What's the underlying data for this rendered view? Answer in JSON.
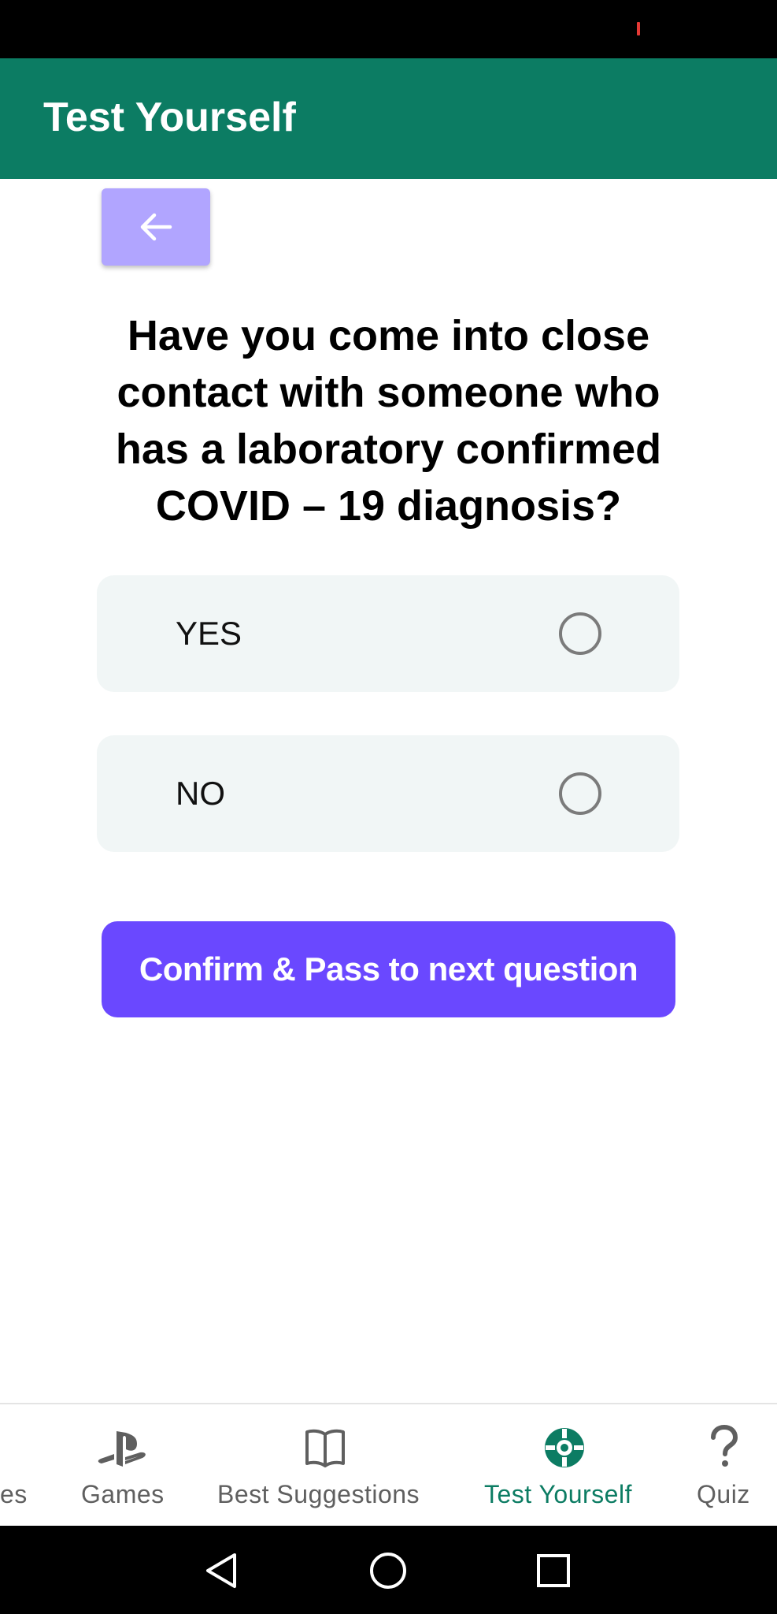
{
  "app": {
    "title": "Test Yourself"
  },
  "back_button": {
    "icon": "arrow-left-icon"
  },
  "question": {
    "text": "Have you come into close contact with someone who has a laboratory confirmed COVID – 19 diagnosis?"
  },
  "options": [
    {
      "label": "YES",
      "selected": false
    },
    {
      "label": "NO",
      "selected": false
    }
  ],
  "confirm": {
    "label": "Confirm & Pass to next question"
  },
  "bottom_nav": {
    "items": [
      {
        "label": "es",
        "icon": "",
        "active": false
      },
      {
        "label": "Games",
        "icon": "playstation-icon",
        "active": false
      },
      {
        "label": "Best Suggestions",
        "icon": "book-icon",
        "active": false
      },
      {
        "label": "Test Yourself",
        "icon": "lifebuoy-icon",
        "active": true
      },
      {
        "label": "Quiz",
        "icon": "question-mark-icon",
        "active": false
      }
    ]
  },
  "system_nav": {
    "buttons": [
      "back-triangle-icon",
      "home-circle-icon",
      "recents-square-icon"
    ]
  },
  "colors": {
    "app_bar": "#0c7c63",
    "back_button": "#b1a5ff",
    "confirm_button": "#6a48ff",
    "option_bg": "#f1f6f6",
    "active_nav": "#0c7c63"
  }
}
